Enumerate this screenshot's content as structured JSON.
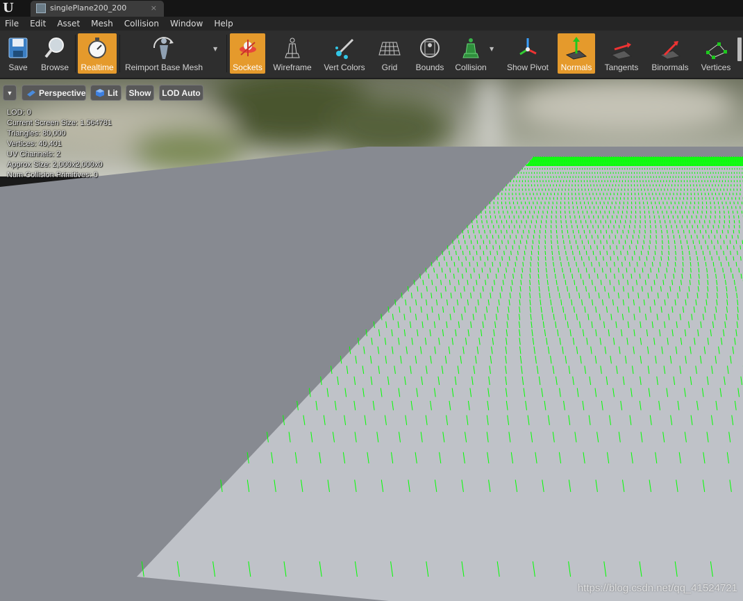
{
  "title_bar": {
    "logo": "U",
    "tab": {
      "label": "singlePlane200_200",
      "close": "×",
      "icon": "static-mesh-icon"
    }
  },
  "menu": [
    "File",
    "Edit",
    "Asset",
    "Mesh",
    "Collision",
    "Window",
    "Help"
  ],
  "toolbar": {
    "save": "Save",
    "browse": "Browse",
    "realtime": "Realtime",
    "reimport": "Reimport Base Mesh",
    "sockets": "Sockets",
    "wireframe": "Wireframe",
    "vert_colors": "Vert Colors",
    "grid": "Grid",
    "bounds": "Bounds",
    "collision": "Collision",
    "show_pivot": "Show Pivot",
    "normals": "Normals",
    "tangents": "Tangents",
    "binormals": "Binormals",
    "vertices": "Vertices",
    "active_color": "#e59a2c"
  },
  "viewport": {
    "perspective": "Perspective",
    "lit": "Lit",
    "show": "Show",
    "lod": "LOD Auto",
    "stats": [
      "LOD:  0",
      "Current Screen Size:  1.564781",
      "Triangles:  80,000",
      "Vertices:  40,401",
      "UV Channels:  2",
      "Approx Size: 2,000x2,000x0",
      "Num Collision Primitives:  0"
    ],
    "normals_color": "#00ff00"
  },
  "watermark": "https://blog.csdn.net/qq_41524721"
}
